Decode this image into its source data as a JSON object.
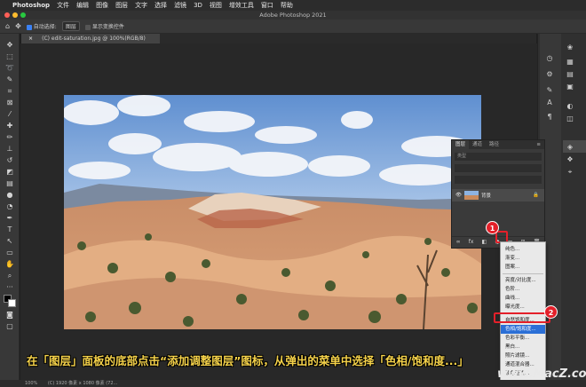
{
  "menubar": {
    "app": "Photoshop",
    "items": [
      "文件",
      "编辑",
      "图像",
      "图层",
      "文字",
      "选择",
      "滤镜",
      "3D",
      "视图",
      "增效工具",
      "窗口",
      "帮助"
    ]
  },
  "window": {
    "title": "Adobe Photoshop 2021"
  },
  "options": {
    "auto_select_label": "自动选择:",
    "auto_select_value": "图层",
    "transform_label": "显示变换控件"
  },
  "document": {
    "tab": "(C) edit-saturation.jpg @ 100%(RGB/8)"
  },
  "layers_panel": {
    "tabs": [
      "图层",
      "通道",
      "路径"
    ],
    "kind_label": "类型",
    "layer_name": "背景"
  },
  "adjust_menu": {
    "items": [
      "纯色...",
      "渐变...",
      "图案...",
      "亮度/对比度...",
      "色阶...",
      "曲线...",
      "曝光度...",
      "自然饱和度...",
      "色相/饱和度...",
      "色彩平衡...",
      "黑白...",
      "照片滤镜...",
      "通道混合器...",
      "颜色查找..."
    ],
    "selected_index": 8
  },
  "badges": {
    "one": "1",
    "two": "2"
  },
  "caption": "在「图层」面板的底部点击“添加调整图层”图标，从弹出的菜单中选择「色相/饱和度...」",
  "status": {
    "zoom": "100%",
    "info": "(C) 1920 像素 x 1080 像素 (72..."
  },
  "watermark": "www.MacZ.com",
  "colors": {
    "accent": "#2b6fd6",
    "highlight": "#e4202a",
    "caption": "#f5d24a"
  }
}
